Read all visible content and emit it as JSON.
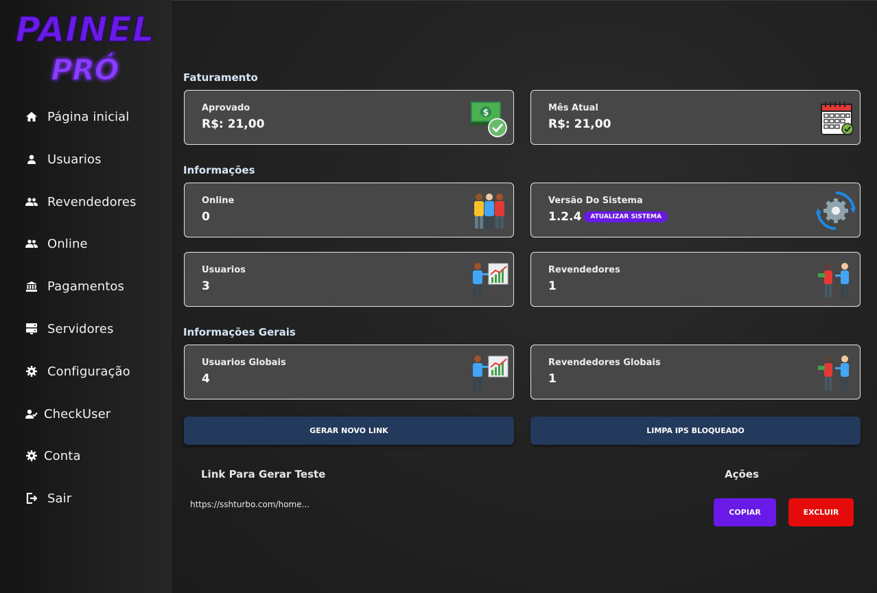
{
  "brand": {
    "line1": "PAINEL",
    "line2": "PRÓ",
    "color": "#6a1ae6"
  },
  "sidebar": {
    "items": [
      {
        "label": "Página inicial",
        "icon": "home-icon"
      },
      {
        "label": "Usuarios",
        "icon": "user-icon"
      },
      {
        "label": "Revendedores",
        "icon": "users-icon"
      },
      {
        "label": "Online",
        "icon": "users-icon"
      },
      {
        "label": "Pagamentos",
        "icon": "bank-icon"
      },
      {
        "label": "Servidores",
        "icon": "server-icon"
      },
      {
        "label": "Configuração",
        "icon": "gear-icon"
      },
      {
        "label": "CheckUser",
        "icon": "user-check-icon"
      },
      {
        "label": "Conta",
        "icon": "gear-icon"
      },
      {
        "label": "Sair",
        "icon": "sign-out-icon"
      }
    ]
  },
  "sections": {
    "faturamento": "Faturamento",
    "informacoes": "Informações",
    "gerais": "Informações Gerais"
  },
  "cards": {
    "aprovado": {
      "label": "Aprovado",
      "value": "R$: 21,00",
      "icon": "money-check-icon"
    },
    "mes_atual": {
      "label": "Mês Atual",
      "value": "R$: 21,00",
      "icon": "calendar-check-icon"
    },
    "online": {
      "label": "Online",
      "value": "0",
      "icon": "people-group-icon"
    },
    "versao": {
      "label": "Versão Do Sistema",
      "value": "1.2.4",
      "badge": "ATUALIZAR SISTEMA",
      "icon": "gear-sync-icon"
    },
    "usuarios": {
      "label": "Usuarios",
      "value": "3",
      "icon": "presenter-chart-icon"
    },
    "revendedores": {
      "label": "Revendedores",
      "value": "1",
      "icon": "money-exchange-icon"
    },
    "usuarios_globais": {
      "label": "Usuarios Globais",
      "value": "4",
      "icon": "presenter-chart-icon"
    },
    "revendedores_globais": {
      "label": "Revendedores Globais",
      "value": "1",
      "icon": "money-exchange-icon"
    }
  },
  "buttons": {
    "gerar_link": "GERAR NOVO LINK",
    "limpa_ips": "LIMPA IPS BLOQUEADO"
  },
  "link_table": {
    "header_link": "Link Para Gerar Teste",
    "header_actions": "Ações",
    "link": "https://sshturbo.com/home...",
    "copy": "COPIAR",
    "delete": "EXCLUIR"
  },
  "colors": {
    "accent": "#6a1ae6",
    "danger": "#e60b0b",
    "button": "#243a5c",
    "card": "#474747"
  }
}
